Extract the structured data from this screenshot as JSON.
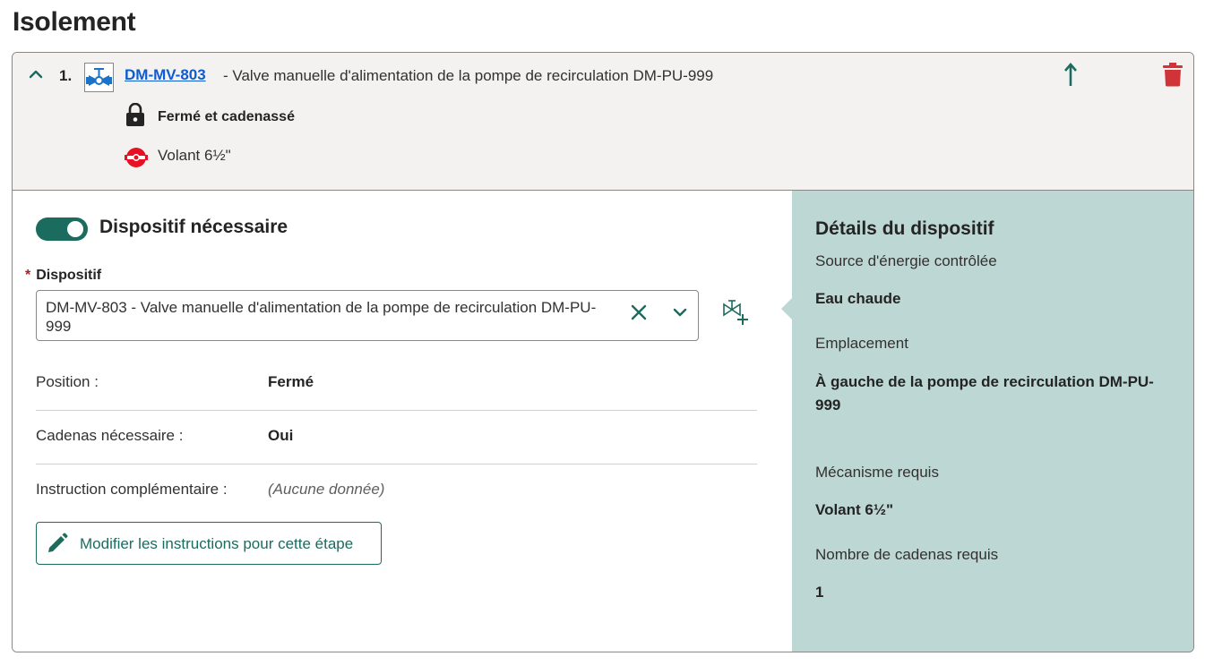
{
  "page": {
    "title": "Isolement"
  },
  "step": {
    "number": "1.",
    "device_code": "DM-MV-803 ",
    "device_description": "- Valve manuelle d'alimentation de la pompe de recirculation DM-PU-999",
    "state": "Fermé et cadenassé",
    "mechanism": "Volant 6½\""
  },
  "form": {
    "toggle_label": "Dispositif nécessaire",
    "toggle_on": true,
    "device_field": {
      "required_mark": "*",
      "label": "Dispositif",
      "value": "DM-MV-803 - Valve manuelle d'alimentation de la pompe de recirculation DM-PU-999"
    },
    "rows": [
      {
        "label": "Position :",
        "value": "Fermé"
      },
      {
        "label": "Cadenas nécessaire :",
        "value": "Oui"
      },
      {
        "label": "Instruction complémentaire :",
        "value": "(Aucune donnée)"
      }
    ],
    "edit_button_label": "Modifier les instructions pour cette étape"
  },
  "details": {
    "title": "Détails du dispositif",
    "items": [
      {
        "label": "Source d'énergie contrôlée",
        "value": "Eau chaude"
      },
      {
        "label": "Emplacement",
        "value": "À gauche de la pompe de recirculation DM-PU-999"
      },
      {
        "label": "Mécanisme requis",
        "value": "Volant 6½\""
      },
      {
        "label": "Nombre de cadenas requis",
        "value": "1"
      }
    ]
  },
  "colors": {
    "accent": "#1c6b5f",
    "link": "#0f5bd0",
    "delete": "#d13438",
    "details_bg": "#bdd8d4",
    "header_bg": "#f3f2f1"
  },
  "icons": [
    "chevron-up-icon",
    "valve-icon",
    "arrow-up-icon",
    "trash-icon",
    "lock-icon",
    "handwheel-icon",
    "close-icon",
    "chevron-down-icon",
    "add-valve-icon",
    "pencil-icon"
  ]
}
